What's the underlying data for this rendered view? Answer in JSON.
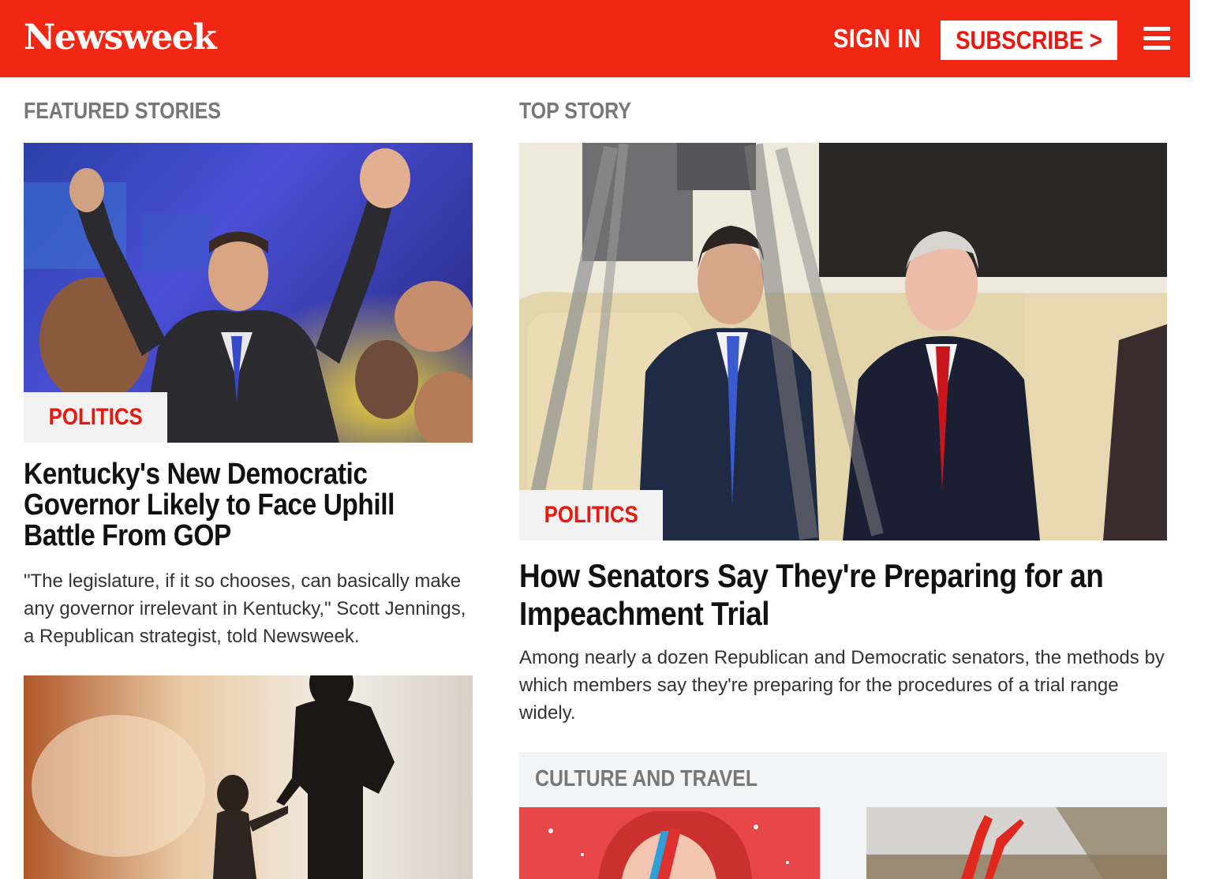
{
  "header": {
    "logo": "Newsweek",
    "sign_in": "SIGN IN",
    "subscribe": "SUBSCRIBE >",
    "menu_icon": "hamburger-menu-icon",
    "brand_color": "#f12613"
  },
  "featured": {
    "label": "FEATURED STORIES",
    "story1": {
      "tag": "POLITICS",
      "headline": "Kentucky's New Democratic Governor Likely to Face Uphill Battle From GOP",
      "dek": "\"The legislature, if it so chooses, can basically make any governor irrelevant in Kentucky,\" Scott Jennings, a Republican strategist, told Newsweek."
    }
  },
  "top_story": {
    "label": "TOP STORY",
    "tag": "POLITICS",
    "headline": "How Senators Say They're Preparing for an Impeachment Trial",
    "dek": "Among nearly a dozen Republican and Democratic senators, the methods by which members say they're preparing for the procedures of a trial range widely."
  },
  "culture": {
    "label": "CULTURE AND TRAVEL"
  }
}
